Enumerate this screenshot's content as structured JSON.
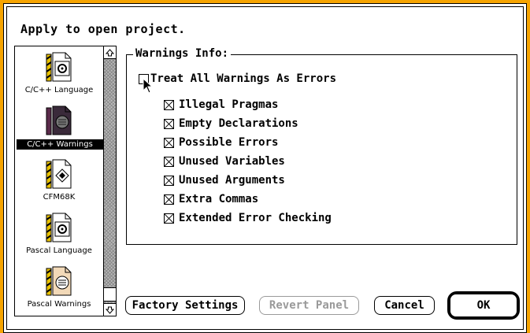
{
  "dialog": {
    "heading": "Apply to open project."
  },
  "panel_list": {
    "items": [
      {
        "label": "C/C++ Language",
        "icon": "gear-doc-icon",
        "selected": false
      },
      {
        "label": "C/C++ Warnings",
        "icon": "warnings-doc-icon",
        "selected": true
      },
      {
        "label": "CFM68K",
        "icon": "diamond-doc-icon",
        "selected": false
      },
      {
        "label": "Pascal Language",
        "icon": "gear-doc-icon",
        "selected": false
      },
      {
        "label": "Pascal Warnings",
        "icon": "list-doc-icon",
        "selected": false
      }
    ]
  },
  "warnings": {
    "title": "Warnings Info:",
    "treat_all": {
      "label": "Treat All Warnings As Errors",
      "checked": false
    },
    "options": [
      {
        "label": "Illegal Pragmas",
        "checked": true
      },
      {
        "label": "Empty Declarations",
        "checked": true
      },
      {
        "label": "Possible Errors",
        "checked": true
      },
      {
        "label": "Unused Variables",
        "checked": true
      },
      {
        "label": "Unused Arguments",
        "checked": true
      },
      {
        "label": "Extra Commas",
        "checked": true
      },
      {
        "label": "Extended Error Checking",
        "checked": true
      }
    ]
  },
  "buttons": {
    "factory": "Factory Settings",
    "revert": "Revert Panel",
    "cancel": "Cancel",
    "ok": "OK"
  },
  "colors": {
    "desktop": "#f6a400",
    "disabled_text": "#9a9a9a"
  }
}
